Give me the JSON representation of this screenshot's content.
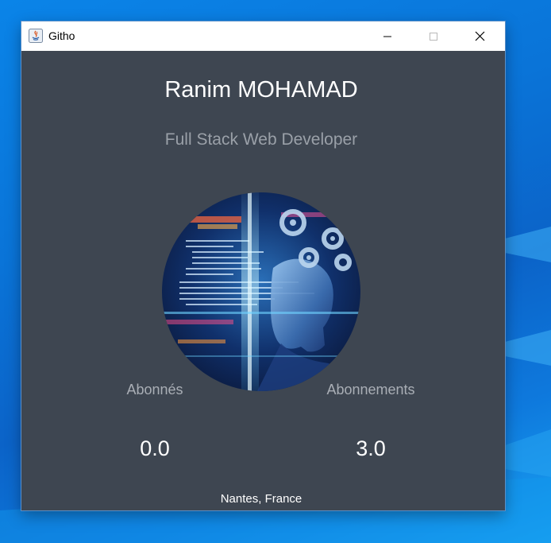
{
  "window": {
    "title": "Githo",
    "controls": {
      "minimize": "minimize-icon",
      "maximize": "maximize-icon",
      "close": "close-icon"
    }
  },
  "profile": {
    "name": "Ranim MOHAMAD",
    "role": "Full Stack Web Developer",
    "avatar": "avatar-image-tech-head",
    "followers_label": "Abonnés",
    "followers_value": "0.0",
    "following_label": "Abonnements",
    "following_value": "3.0",
    "location": "Nantes, France"
  },
  "colors": {
    "window_bg": "#3e4651",
    "titlebar_bg": "#ffffff",
    "desktop_bg": "#0a74d8",
    "name_text": "#ffffff",
    "muted_text": "#9aa0a8"
  }
}
